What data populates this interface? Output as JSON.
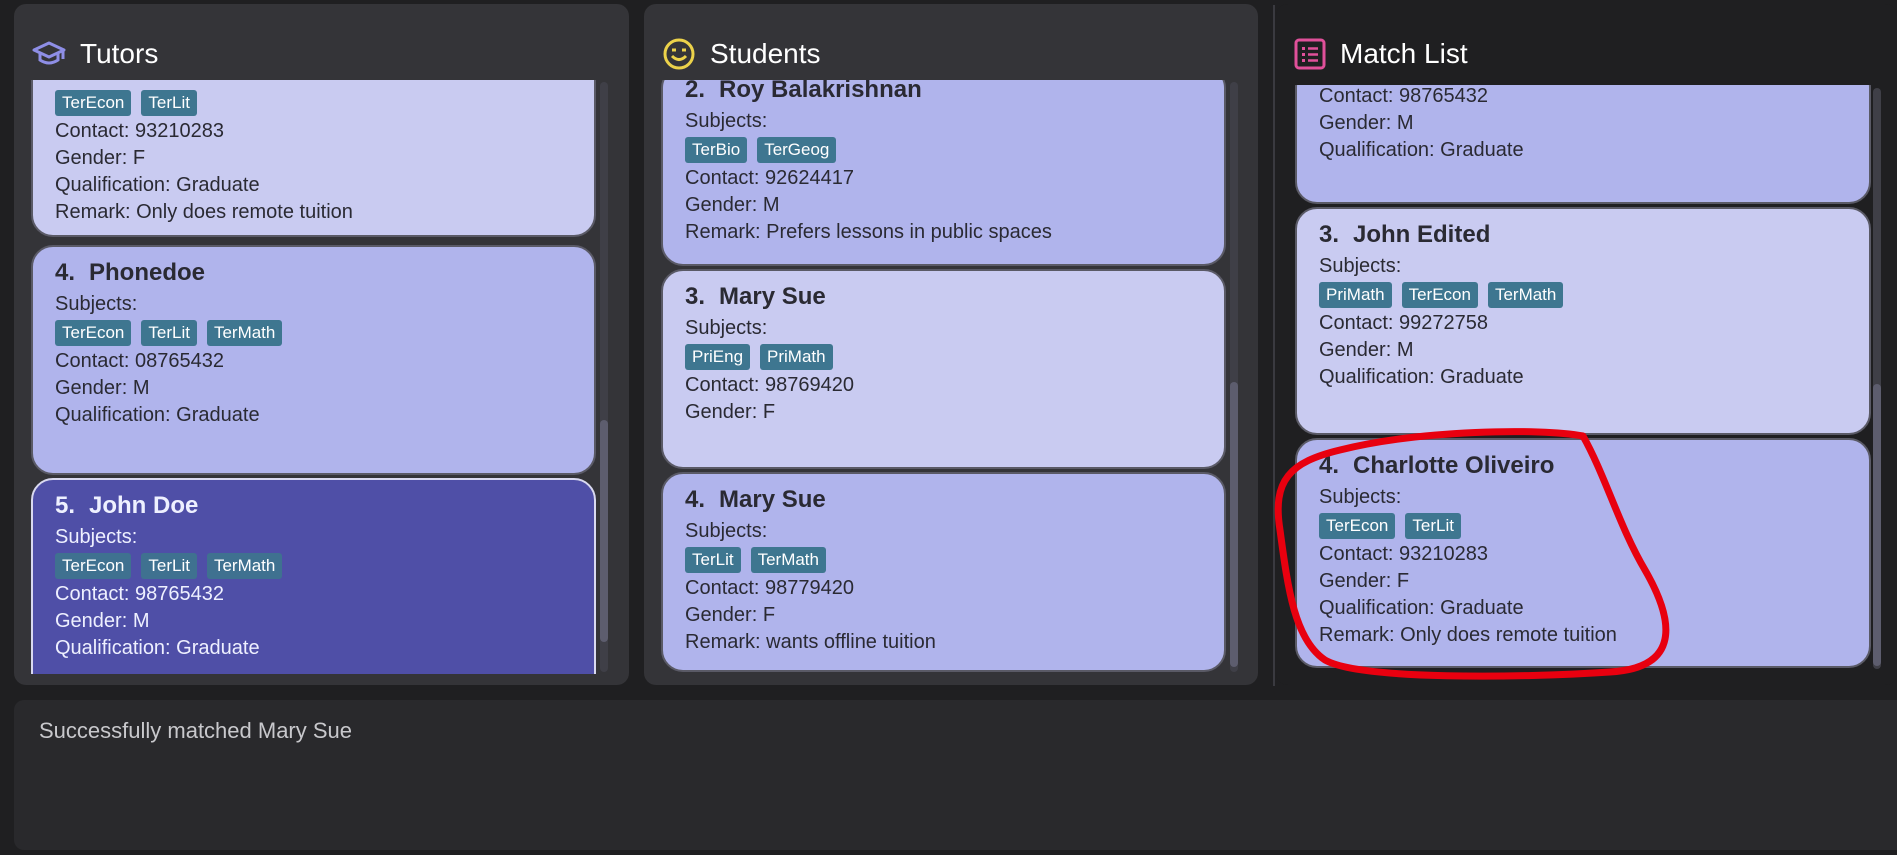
{
  "panels": {
    "tutors": {
      "title": "Tutors",
      "icon": "graduation-cap-icon",
      "cards": [
        {
          "index": "",
          "name": "",
          "subjects_label": "",
          "tags": [
            "TerEcon",
            "TerLit"
          ],
          "contact": "Contact: 93210283",
          "gender": "Gender: F",
          "qualification": "Qualification: Graduate",
          "remark": "Remark: Only does remote tuition"
        },
        {
          "index": "4.",
          "name": "Phonedoe",
          "subjects_label": "Subjects:",
          "tags": [
            "TerEcon",
            "TerLit",
            "TerMath"
          ],
          "contact": "Contact: 08765432",
          "gender": "Gender: M",
          "qualification": "Qualification: Graduate"
        },
        {
          "index": "5.",
          "name": "John Doe",
          "subjects_label": "Subjects:",
          "tags": [
            "TerEcon",
            "TerLit",
            "TerMath"
          ],
          "contact": "Contact: 98765432",
          "gender": "Gender: M",
          "qualification": "Qualification: Graduate"
        }
      ]
    },
    "students": {
      "title": "Students",
      "icon": "smiley-face-icon",
      "cards": [
        {
          "index": "2.",
          "name": "Roy Balakrishnan",
          "subjects_label": "Subjects:",
          "tags": [
            "TerBio",
            "TerGeog"
          ],
          "contact": "Contact: 92624417",
          "gender": "Gender: M",
          "remark": "Remark: Prefers lessons in public spaces"
        },
        {
          "index": "3.",
          "name": "Mary Sue",
          "subjects_label": "Subjects:",
          "tags": [
            "PriEng",
            "PriMath"
          ],
          "contact": "Contact: 98769420",
          "gender": "Gender: F"
        },
        {
          "index": "4.",
          "name": "Mary Sue",
          "subjects_label": "Subjects:",
          "tags": [
            "TerLit",
            "TerMath"
          ],
          "contact": "Contact: 98779420",
          "gender": "Gender: F",
          "remark": "Remark: wants offline tuition"
        }
      ]
    },
    "matchlist": {
      "title": "Match List",
      "icon": "list-icon",
      "cards": [
        {
          "contact": "Contact: 98765432",
          "gender": "Gender: M",
          "qualification": "Qualification: Graduate"
        },
        {
          "index": "3.",
          "name": "John Edited",
          "subjects_label": "Subjects:",
          "tags": [
            "PriMath",
            "TerEcon",
            "TerMath"
          ],
          "contact": "Contact: 99272758",
          "gender": "Gender: M",
          "qualification": "Qualification: Graduate"
        },
        {
          "index": "4.",
          "name": "Charlotte Oliveiro",
          "subjects_label": "Subjects:",
          "tags": [
            "TerEcon",
            "TerLit"
          ],
          "contact": "Contact: 93210283",
          "gender": "Gender: F",
          "qualification": "Qualification: Graduate",
          "remark": "Remark: Only does remote tuition"
        }
      ]
    }
  },
  "result": {
    "message": "Successfully matched Mary Sue"
  },
  "colors": {
    "annotation": "#e8000f",
    "selected_card": "#4f4fa7",
    "tag": "#3e7690"
  }
}
